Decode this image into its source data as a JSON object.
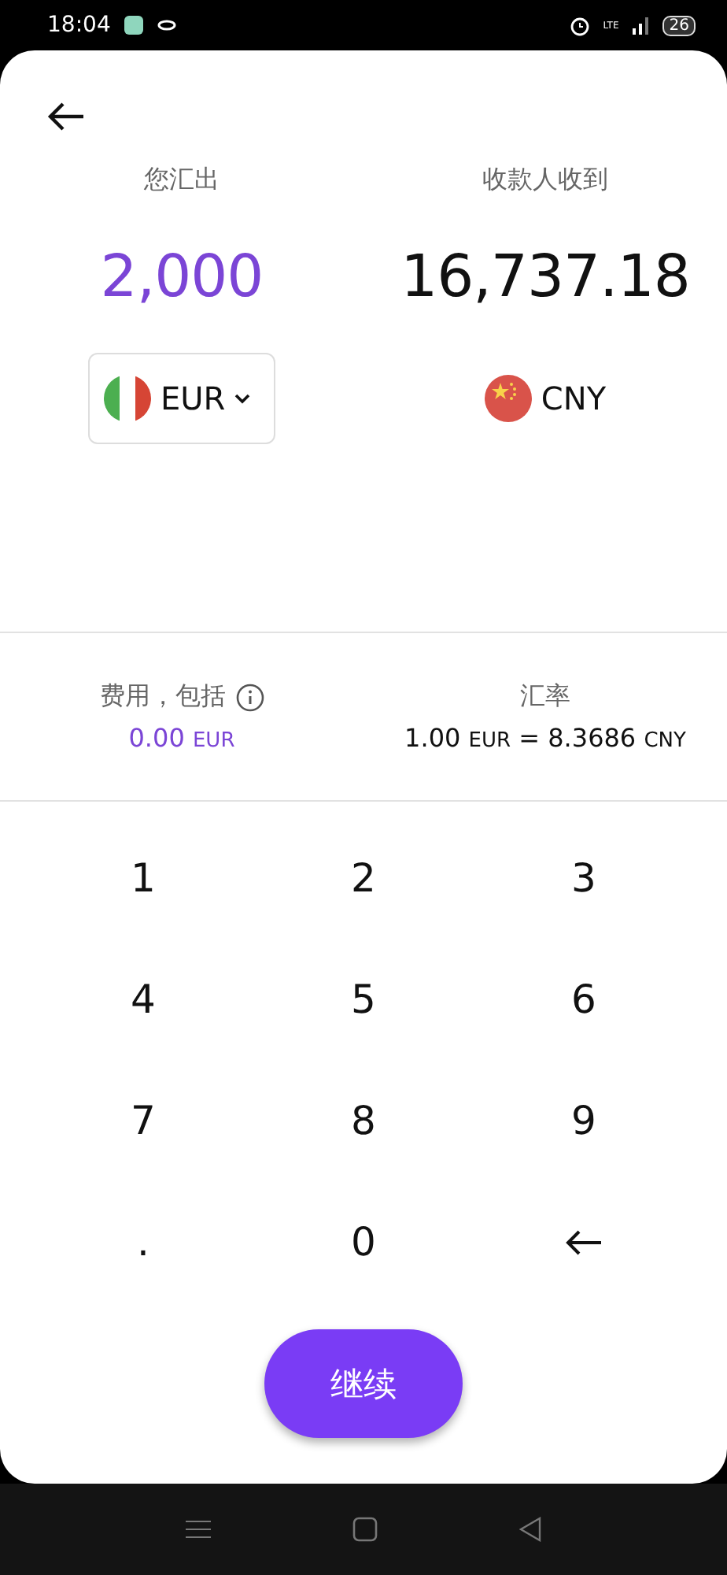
{
  "status_bar": {
    "time": "18:04",
    "network": "LTE",
    "battery": "26"
  },
  "send": {
    "label": "您汇出",
    "amount": "2,000",
    "currency": "EUR",
    "dropdown": true
  },
  "receive": {
    "label": "收款人收到",
    "amount": "16,737.18",
    "currency": "CNY",
    "dropdown": false
  },
  "fee": {
    "label": "费用，包括",
    "amount": "0.00",
    "currency": "EUR"
  },
  "rate": {
    "label": "汇率",
    "parts": [
      {
        "kind": "number",
        "text": "1.00"
      },
      {
        "kind": "code",
        "text": "EUR"
      },
      {
        "kind": "number",
        "text": "="
      },
      {
        "kind": "number",
        "text": "8.3686"
      },
      {
        "kind": "code",
        "text": "CNY"
      }
    ]
  },
  "keypad": [
    {
      "kind": "digit",
      "text": "1"
    },
    {
      "kind": "digit",
      "text": "2"
    },
    {
      "kind": "digit",
      "text": "3"
    },
    {
      "kind": "digit",
      "text": "4"
    },
    {
      "kind": "digit",
      "text": "5"
    },
    {
      "kind": "digit",
      "text": "6"
    },
    {
      "kind": "digit",
      "text": "7"
    },
    {
      "kind": "digit",
      "text": "8"
    },
    {
      "kind": "digit",
      "text": "9"
    },
    {
      "kind": "digit",
      "text": "."
    },
    {
      "kind": "digit",
      "text": "0"
    },
    {
      "kind": "backspace"
    }
  ],
  "continue_button": "继续"
}
